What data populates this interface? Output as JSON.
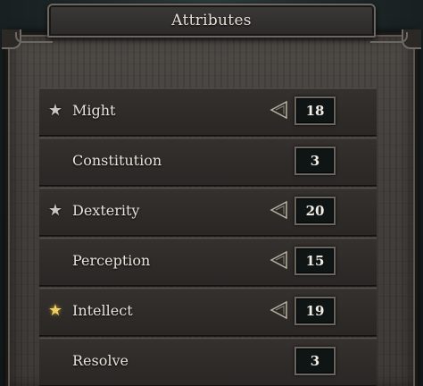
{
  "panel": {
    "title": "Attributes"
  },
  "attributes": [
    {
      "name": "Might",
      "value": "18",
      "star": "silver",
      "has_decrease": true
    },
    {
      "name": "Constitution",
      "value": "3",
      "star": "",
      "has_decrease": false
    },
    {
      "name": "Dexterity",
      "value": "20",
      "star": "silver",
      "has_decrease": true
    },
    {
      "name": "Perception",
      "value": "15",
      "star": "",
      "has_decrease": true
    },
    {
      "name": "Intellect",
      "value": "19",
      "star": "gold",
      "has_decrease": true
    },
    {
      "name": "Resolve",
      "value": "3",
      "star": "",
      "has_decrease": false
    }
  ],
  "icons": {
    "star": "star-icon",
    "decrease": "decrease-arrow-icon"
  },
  "colors": {
    "star_silver": "#c9c6c0",
    "star_gold": "#f0cf62",
    "text": "#e8e3da"
  }
}
